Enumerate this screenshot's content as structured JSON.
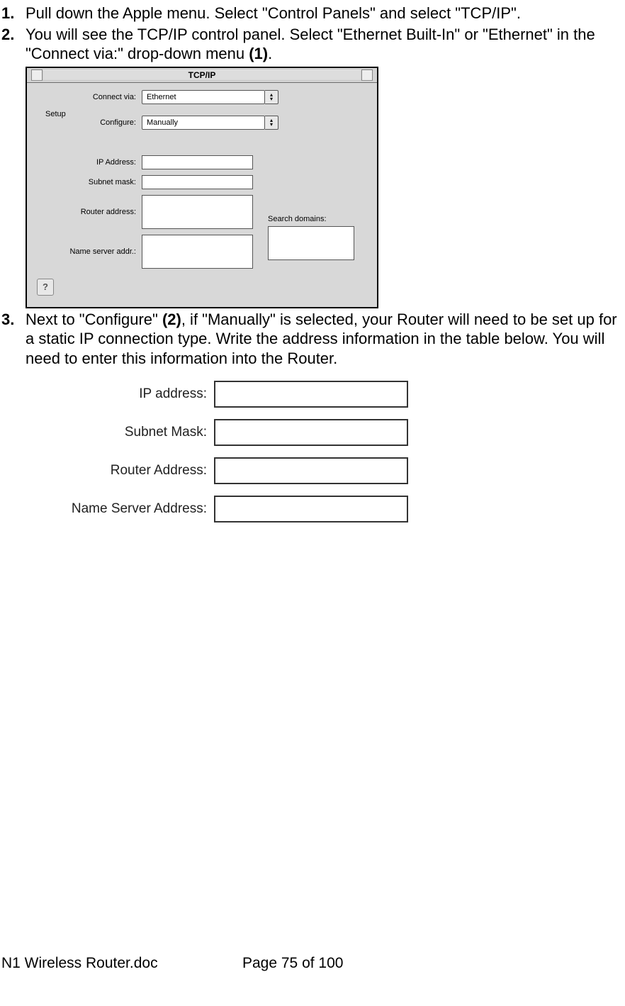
{
  "steps": {
    "s1": {
      "num": "1.",
      "text": "Pull down the Apple menu. Select \"Control Panels\" and select \"TCP/IP\"."
    },
    "s2": {
      "num": "2.",
      "text_a": "You will see the TCP/IP control panel. Select \"Ethernet Built-In\" or \"Ethernet\" in the \"Connect via:\" drop-down menu ",
      "text_b": "(1)",
      "text_c": "."
    },
    "s3": {
      "num": "3.",
      "text_a": "Next to \"Configure\" ",
      "text_b": "(2)",
      "text_c": ", if \"Manually\" is selected, your Router will need to be set up for a static IP connection type. Write the address information in the table below. You will need to enter this information into the Router."
    }
  },
  "panel": {
    "title": "TCP/IP",
    "connect_label": "Connect via:",
    "connect_value": "Ethernet",
    "setup_label": "Setup",
    "configure_label": "Configure:",
    "configure_value": "Manually",
    "ip_label": "IP Address:",
    "subnet_label": "Subnet mask:",
    "router_label": "Router address:",
    "ns_label": "Name server addr.:",
    "search_label": "Search domains:",
    "help_glyph": "?"
  },
  "form": {
    "ip": "IP address:",
    "subnet": "Subnet Mask:",
    "router": "Router Address:",
    "ns": "Name Server Address:"
  },
  "footer": {
    "file": "N1 Wireless Router.doc",
    "page": "Page 75 of 100"
  }
}
